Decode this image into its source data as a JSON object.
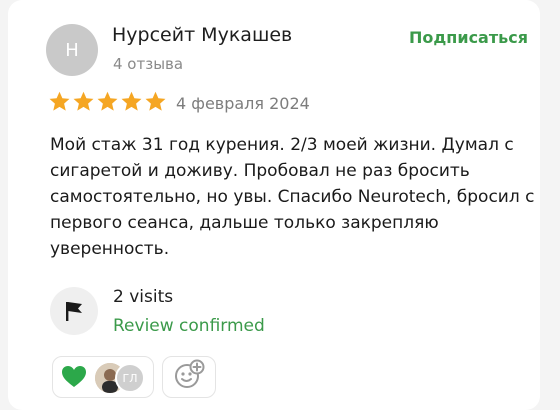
{
  "review": {
    "author_initial": "Н",
    "author_name": "Нурсейт Мукашев",
    "author_reviews": "4 отзыва",
    "subscribe_label": "Подписаться",
    "rating": 5,
    "rating_max": 5,
    "date": "4 февраля 2024",
    "text": "Мой стаж 31 год курения. 2/3 моей жизни. Думал с сигаретой и доживу. Пробовал не раз бросить самостоятельно, но увы. Спасибо Neurotech, бросил с первого сеанса, дальше только закрепляю уверенность."
  },
  "visits": {
    "icon": "flag-icon",
    "count_label": "2 visits",
    "status": "Review confirmed"
  },
  "reactions": {
    "emoji": "💚",
    "avatar_initials": "ГЛ",
    "add_icon": "add-reaction-icon"
  },
  "colors": {
    "accent_green": "#3b9a4a",
    "star_orange": "#f5a623",
    "muted_gray": "#8a8a8a"
  }
}
